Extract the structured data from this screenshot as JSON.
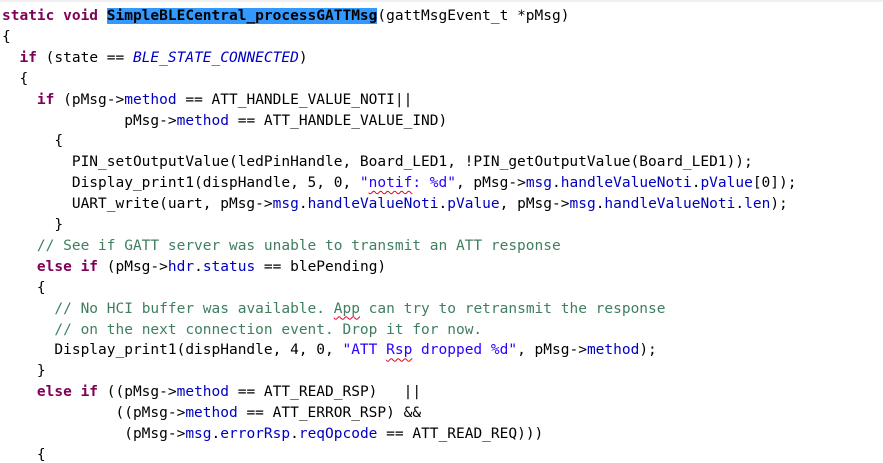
{
  "editor": {
    "colors": {
      "keyword": "#7f0055",
      "field": "#0000c0",
      "string": "#2a00ff",
      "comment": "#3f7f5f",
      "selection": "#3399ff"
    },
    "lines": [
      {
        "id": "l1",
        "segments": [
          {
            "t": "static void ",
            "c": "kw"
          },
          {
            "t": "SimpleBLECentral_processGATTMsg",
            "c": "hl"
          },
          {
            "t": "(gattMsgEvent_t *pMsg)",
            "c": ""
          }
        ]
      },
      {
        "id": "l2",
        "segments": [
          {
            "t": "{",
            "c": ""
          }
        ]
      },
      {
        "id": "l3",
        "segments": [
          {
            "t": "  ",
            "c": ""
          },
          {
            "t": "if",
            "c": "kw"
          },
          {
            "t": " (state == ",
            "c": ""
          },
          {
            "t": "BLE_STATE_CONNECTED",
            "c": "const"
          },
          {
            "t": ")",
            "c": ""
          }
        ]
      },
      {
        "id": "l4",
        "segments": [
          {
            "t": "  {",
            "c": ""
          }
        ]
      },
      {
        "id": "l5",
        "segments": [
          {
            "t": "    ",
            "c": ""
          },
          {
            "t": "if",
            "c": "kw"
          },
          {
            "t": " (pMsg->",
            "c": ""
          },
          {
            "t": "method",
            "c": "field"
          },
          {
            "t": " == ATT_HANDLE_VALUE_NOTI||",
            "c": ""
          }
        ]
      },
      {
        "id": "l6",
        "segments": [
          {
            "t": "              pMsg->",
            "c": ""
          },
          {
            "t": "method",
            "c": "field"
          },
          {
            "t": " == ATT_HANDLE_VALUE_IND)",
            "c": ""
          }
        ]
      },
      {
        "id": "l7",
        "segments": [
          {
            "t": "      {",
            "c": ""
          }
        ]
      },
      {
        "id": "l8",
        "segments": [
          {
            "t": "        PIN_setOutputValue(ledPinHandle, Board_LED1, !PIN_getOutputValue(Board_LED1));",
            "c": ""
          }
        ]
      },
      {
        "id": "l9",
        "segments": [
          {
            "t": "        Display_print1(dispHandle, 5, 0, ",
            "c": ""
          },
          {
            "t": "\"",
            "c": "str"
          },
          {
            "t": "notif",
            "c": "str squig"
          },
          {
            "t": ": %d\"",
            "c": "str"
          },
          {
            "t": ", pMsg->",
            "c": ""
          },
          {
            "t": "msg",
            "c": "field"
          },
          {
            "t": ".",
            "c": ""
          },
          {
            "t": "handleValueNoti",
            "c": "field"
          },
          {
            "t": ".",
            "c": ""
          },
          {
            "t": "pValue",
            "c": "field"
          },
          {
            "t": "[0]);",
            "c": ""
          }
        ]
      },
      {
        "id": "l10",
        "segments": [
          {
            "t": "        UART_write(uart, pMsg->",
            "c": ""
          },
          {
            "t": "msg",
            "c": "field"
          },
          {
            "t": ".",
            "c": ""
          },
          {
            "t": "handleValueNoti",
            "c": "field"
          },
          {
            "t": ".",
            "c": ""
          },
          {
            "t": "pValue",
            "c": "field"
          },
          {
            "t": ", pMsg->",
            "c": ""
          },
          {
            "t": "msg",
            "c": "field"
          },
          {
            "t": ".",
            "c": ""
          },
          {
            "t": "handleValueNoti",
            "c": "field"
          },
          {
            "t": ".",
            "c": ""
          },
          {
            "t": "len",
            "c": "field"
          },
          {
            "t": ");",
            "c": ""
          }
        ]
      },
      {
        "id": "l11",
        "segments": [
          {
            "t": "      }",
            "c": ""
          }
        ]
      },
      {
        "id": "l12",
        "segments": [
          {
            "t": "    ",
            "c": ""
          },
          {
            "t": "// See if GATT server was unable to transmit an ATT response",
            "c": "cmt"
          }
        ]
      },
      {
        "id": "l13",
        "segments": [
          {
            "t": "    ",
            "c": ""
          },
          {
            "t": "else if",
            "c": "kw"
          },
          {
            "t": " (pMsg->",
            "c": ""
          },
          {
            "t": "hdr",
            "c": "field"
          },
          {
            "t": ".",
            "c": ""
          },
          {
            "t": "status",
            "c": "field"
          },
          {
            "t": " == blePending)",
            "c": ""
          }
        ]
      },
      {
        "id": "l14",
        "segments": [
          {
            "t": "    {",
            "c": ""
          }
        ]
      },
      {
        "id": "l15",
        "segments": [
          {
            "t": "      ",
            "c": ""
          },
          {
            "t": "// No HCI buffer was available. ",
            "c": "cmt"
          },
          {
            "t": "App",
            "c": "cmt squig"
          },
          {
            "t": " can try to retransmit the response",
            "c": "cmt"
          }
        ]
      },
      {
        "id": "l16",
        "segments": [
          {
            "t": "      ",
            "c": ""
          },
          {
            "t": "// on the next connection event. Drop it for now.",
            "c": "cmt"
          }
        ]
      },
      {
        "id": "l17",
        "segments": [
          {
            "t": "      Display_print1(dispHandle, 4, 0, ",
            "c": ""
          },
          {
            "t": "\"ATT ",
            "c": "str"
          },
          {
            "t": "Rsp",
            "c": "str squig"
          },
          {
            "t": " dropped %d\"",
            "c": "str"
          },
          {
            "t": ", pMsg->",
            "c": ""
          },
          {
            "t": "method",
            "c": "field"
          },
          {
            "t": ");",
            "c": ""
          }
        ]
      },
      {
        "id": "l18",
        "segments": [
          {
            "t": "    }",
            "c": ""
          }
        ]
      },
      {
        "id": "l19",
        "segments": [
          {
            "t": "    ",
            "c": ""
          },
          {
            "t": "else if",
            "c": "kw"
          },
          {
            "t": " ((pMsg->",
            "c": ""
          },
          {
            "t": "method",
            "c": "field"
          },
          {
            "t": " == ATT_READ_RSP)   ||",
            "c": ""
          }
        ]
      },
      {
        "id": "l20",
        "segments": [
          {
            "t": "             ((pMsg->",
            "c": ""
          },
          {
            "t": "method",
            "c": "field"
          },
          {
            "t": " == ATT_ERROR_RSP) &&",
            "c": ""
          }
        ]
      },
      {
        "id": "l21",
        "segments": [
          {
            "t": "              (pMsg->",
            "c": ""
          },
          {
            "t": "msg",
            "c": "field"
          },
          {
            "t": ".",
            "c": ""
          },
          {
            "t": "errorRsp",
            "c": "field"
          },
          {
            "t": ".",
            "c": ""
          },
          {
            "t": "reqOpcode",
            "c": "field"
          },
          {
            "t": " == ATT_READ_REQ)))",
            "c": ""
          }
        ]
      },
      {
        "id": "l22",
        "segments": [
          {
            "t": "    {",
            "c": ""
          }
        ]
      }
    ]
  }
}
